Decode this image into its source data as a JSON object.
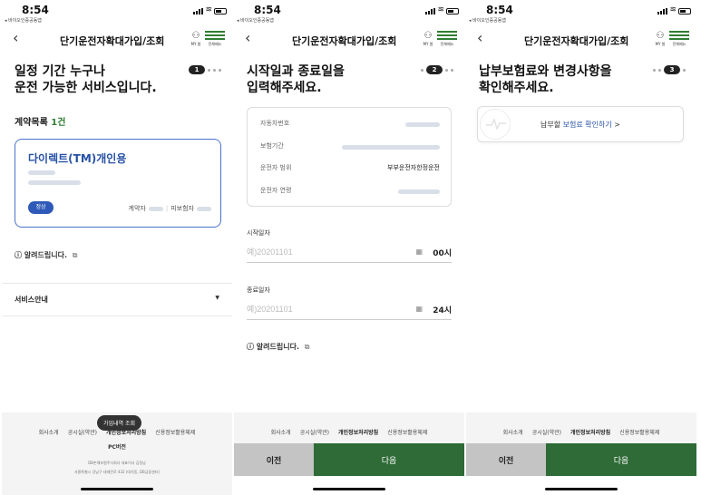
{
  "status": {
    "time": "8:54",
    "carrier": "◂ 바이오인증공동앱"
  },
  "header": {
    "title": "단기운전자확대가입/조회",
    "my": "MY 봄",
    "menu": "전체메뉴"
  },
  "screen1": {
    "step": "1",
    "headline_line1": "일정 기간 누구나",
    "headline_line2": "운전 가능한 서비스입니다.",
    "contracts_label": "계약목록",
    "contracts_count": "1건",
    "card": {
      "name": "다이렉트(TM)개인용",
      "status": "정상",
      "contractor_label": "계약자",
      "insured_label": "피보험자"
    },
    "notice": "알려드립니다.",
    "service_label": "서비스안내",
    "tooltip": "가입내역 조회",
    "footer_links": [
      "회사소개",
      "공시실(약관)",
      "개인정보처리방침",
      "신용정보활용체제"
    ],
    "pc_version": "PC버전",
    "company_info_1": "DB손해보험주식회사   대표이사 김정남",
    "company_info_2": "서울특별시 강남구 테헤란로 432 (대치동, DB금융센터)"
  },
  "screen2": {
    "step": "2",
    "headline_line1": "시작일과 종료일을",
    "headline_line2": "입력해주세요.",
    "vehicle": {
      "car_no_label": "자동차번호",
      "period_label": "보험기간",
      "driver_range_label": "운전자 범위",
      "driver_range_value": "부부운전자한정운전",
      "driver_age_label": "운전자 연령"
    },
    "start_label": "시작일자",
    "start_placeholder": "예)20201101",
    "start_hour": "00시",
    "end_label": "종료일자",
    "end_placeholder": "예)20201101",
    "end_hour": "24시",
    "notice": "알려드립니다.",
    "prev": "이전",
    "next": "다음"
  },
  "screen3": {
    "step": "3",
    "headline_line1": "납부보험료와 변경사항을",
    "headline_line2": "확인해주세요.",
    "pay_text": "납부할",
    "pay_link": "보험료 확인하기",
    "pay_arrow": ">",
    "prev": "이전",
    "next": "다음"
  },
  "icons": {
    "back": "chevron-left-icon",
    "external": "external-link-icon",
    "calendar": "calendar-icon",
    "info": "info-circle-icon"
  },
  "colors": {
    "accent_green": "#2e6b36",
    "link_blue": "#2651a6",
    "badge_blue": "#2f59b8"
  }
}
